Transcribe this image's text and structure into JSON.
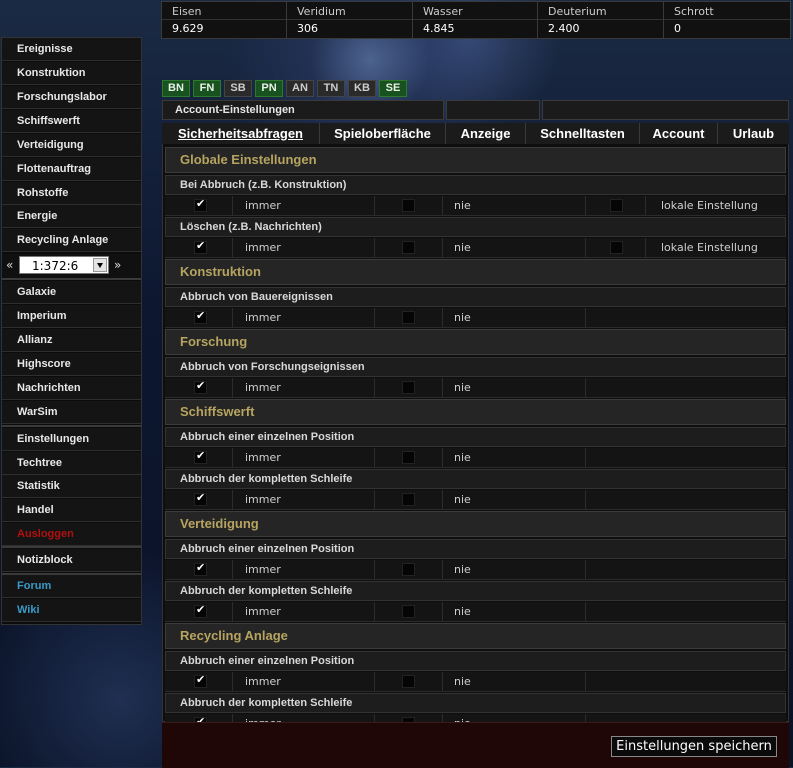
{
  "resources": [
    {
      "label": "Eisen",
      "value": "9.629"
    },
    {
      "label": "Veridium",
      "value": "306"
    },
    {
      "label": "Wasser",
      "value": "4.845"
    },
    {
      "label": "Deuterium",
      "value": "2.400"
    },
    {
      "label": "Schrott",
      "value": "0"
    }
  ],
  "sidebar": {
    "items": [
      "Ereignisse",
      "Konstruktion",
      "Forschungslabor",
      "Schiffswerft",
      "Verteidigung",
      "Flottenauftrag",
      "Rohstoffe",
      "Energie",
      "Recycling Anlage"
    ],
    "coord": {
      "prev": "«",
      "value": "1:372:6",
      "next": "»"
    },
    "items2": [
      "Galaxie",
      "Imperium",
      "Allianz",
      "Highscore",
      "Nachrichten",
      "WarSim"
    ],
    "items3": [
      "Einstellungen",
      "Techtree",
      "Statistik",
      "Handel"
    ],
    "logout": "Ausloggen",
    "notes": "Notizblock",
    "links": [
      "Forum",
      "Wiki"
    ]
  },
  "planet_tabs": [
    {
      "label": "BN",
      "active": true
    },
    {
      "label": "FN",
      "active": true
    },
    {
      "label": "SB",
      "active": false
    },
    {
      "label": "PN",
      "active": true
    },
    {
      "label": "AN",
      "active": false
    },
    {
      "label": "TN",
      "active": false
    },
    {
      "label": "KB",
      "active": false
    },
    {
      "label": "SE",
      "active": true
    }
  ],
  "title": "Account-Einstellungen",
  "tabs": [
    "Sicherheitsabfragen",
    "Spieloberfläche",
    "Anzeige",
    "Schnelltasten",
    "Account",
    "Urlaub"
  ],
  "labels": {
    "immer": "immer",
    "nie": "nie",
    "lokal": "lokale Einstellung"
  },
  "sections": [
    {
      "title": "Globale Einstellungen",
      "rows": [
        {
          "label": "Bei Abbruch (z.B. Konstruktion)",
          "local": true
        },
        {
          "label": "Löschen (z.B. Nachrichten)",
          "local": true
        }
      ]
    },
    {
      "title": "Konstruktion",
      "rows": [
        {
          "label": "Abbruch von Bauereignissen",
          "local": false
        }
      ]
    },
    {
      "title": "Forschung",
      "rows": [
        {
          "label": "Abbruch von Forschungseignissen",
          "local": false
        }
      ]
    },
    {
      "title": "Schiffswerft",
      "rows": [
        {
          "label": "Abbruch einer einzelnen Position",
          "local": false
        },
        {
          "label": "Abbruch der kompletten Schleife",
          "local": false
        }
      ]
    },
    {
      "title": "Verteidigung",
      "rows": [
        {
          "label": "Abbruch einer einzelnen Position",
          "local": false
        },
        {
          "label": "Abbruch der kompletten Schleife",
          "local": false
        }
      ]
    },
    {
      "title": "Recycling Anlage",
      "rows": [
        {
          "label": "Abbruch einer einzelnen Position",
          "local": false
        },
        {
          "label": "Abbruch der kompletten Schleife",
          "local": false
        }
      ]
    }
  ],
  "save_label": "Einstellungen speichern"
}
